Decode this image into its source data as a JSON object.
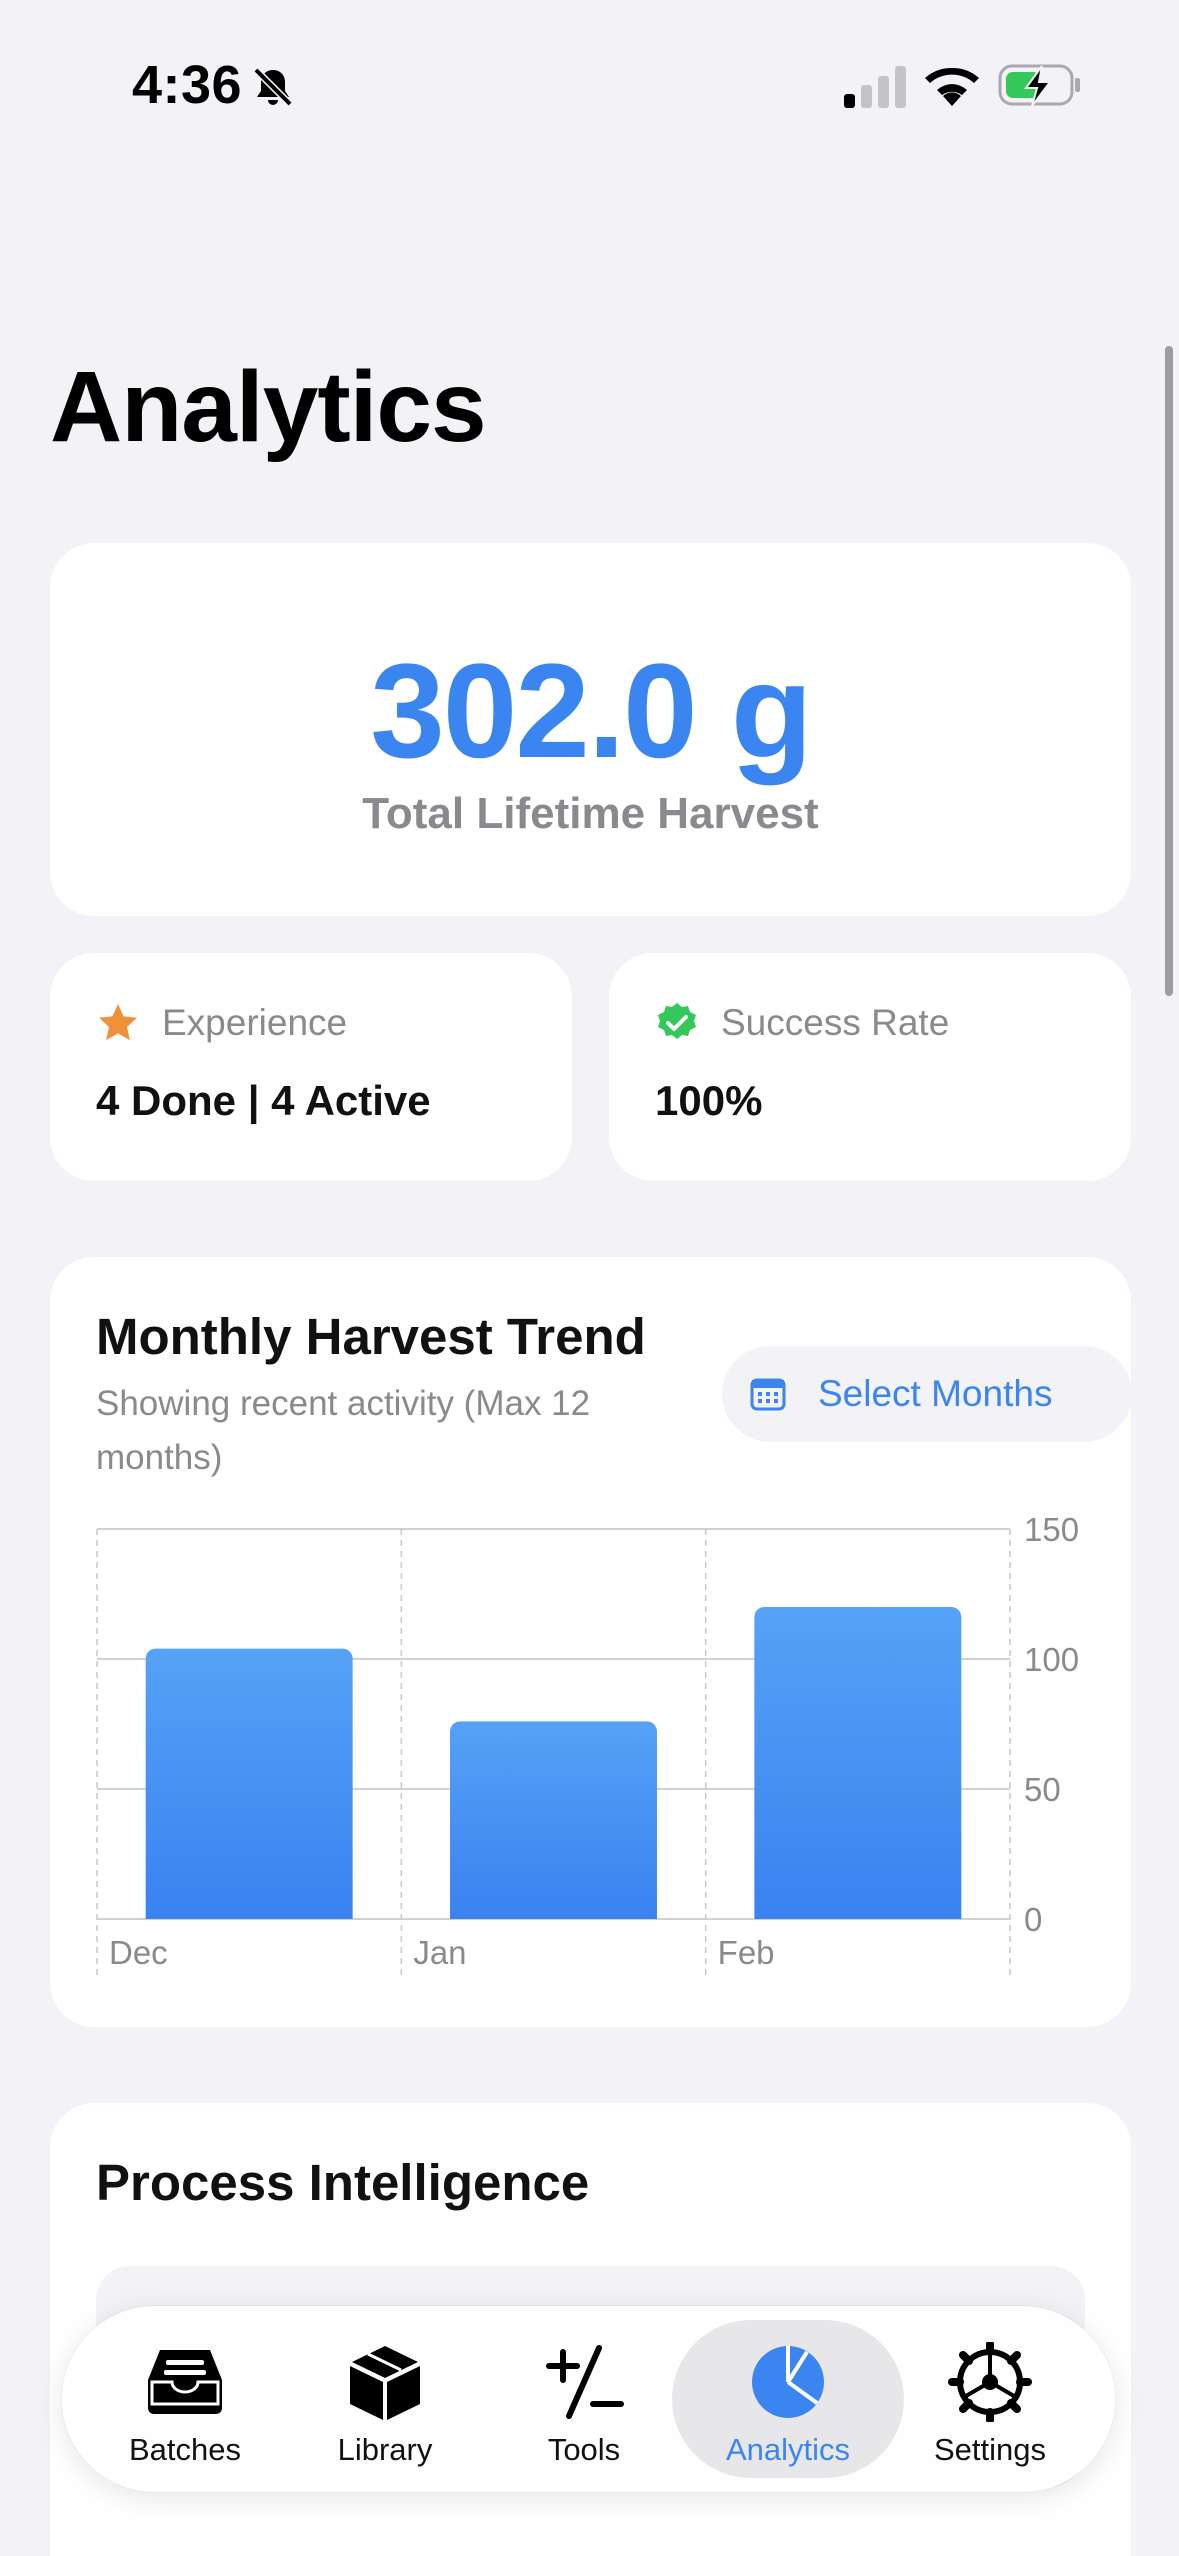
{
  "status_bar": {
    "time": "4:36"
  },
  "page": {
    "title": "Analytics"
  },
  "harvest": {
    "value": "302.0 g",
    "label": "Total Lifetime Harvest"
  },
  "stats": {
    "experience": {
      "label": "Experience",
      "value": "4 Done | 4 Active",
      "icon": "star-icon",
      "color": "#f0913a"
    },
    "success": {
      "label": "Success Rate",
      "value": "100%",
      "icon": "checkmark-seal-icon",
      "color": "#34c759"
    }
  },
  "trend": {
    "title": "Monthly Harvest Trend",
    "subtitle": "Showing recent activity (Max 12 months)",
    "select_label": "Select Months"
  },
  "chart_data": {
    "type": "bar",
    "categories": [
      "Dec",
      "Jan",
      "Feb"
    ],
    "values": [
      104,
      76,
      120
    ],
    "ylim": [
      0,
      150
    ],
    "yticks": [
      0,
      50,
      100,
      150
    ],
    "grid": true,
    "color": "#3b85f0"
  },
  "process": {
    "title": "Process Intelligence"
  },
  "tabs": [
    {
      "label": "Batches",
      "icon": "tray-icon"
    },
    {
      "label": "Library",
      "icon": "cube-icon"
    },
    {
      "label": "Tools",
      "icon": "plus-minus-icon"
    },
    {
      "label": "Analytics",
      "icon": "pie-chart-icon",
      "active": true
    },
    {
      "label": "Settings",
      "icon": "gear-icon"
    }
  ],
  "accent_color": "#3b85f0"
}
